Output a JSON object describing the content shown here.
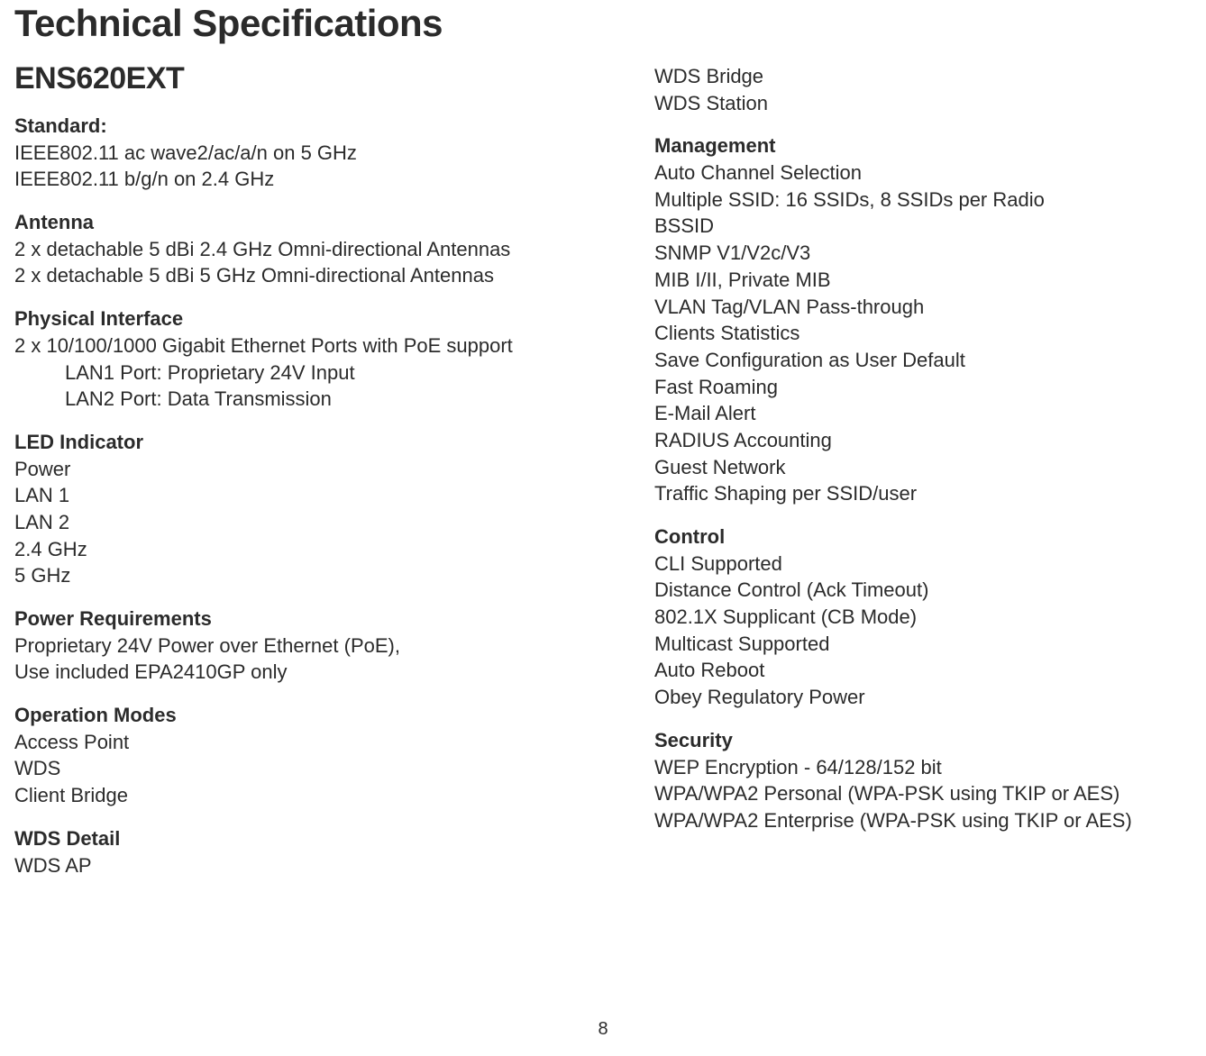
{
  "title": "Technical Specifications",
  "model": "ENS620EXT",
  "page_number": "8",
  "left": {
    "standard": {
      "head": "Standard:",
      "l1": "IEEE802.11 ac wave2/ac/a/n on 5 GHz",
      "l2": "IEEE802.11 b/g/n on 2.4 GHz"
    },
    "antenna": {
      "head": "Antenna",
      "l1": "2 x detachable 5 dBi 2.4 GHz Omni-directional Antennas",
      "l2": "2 x detachable 5 dBi 5 GHz Omni-directional Antennas"
    },
    "phys": {
      "head": "Physical Interface",
      "l1": "2 x 10/100/1000 Gigabit Ethernet Ports with PoE support",
      "l2": "LAN1 Port: Proprietary 24V Input",
      "l3": "LAN2 Port: Data Transmission"
    },
    "led": {
      "head": "LED Indicator",
      "l1": "Power",
      "l2": "LAN 1",
      "l3": "LAN 2",
      "l4": "2.4 GHz",
      "l5": "5 GHz"
    },
    "power": {
      "head": "Power Requirements",
      "l1": "Proprietary 24V Power over Ethernet (PoE),",
      "l2": "Use included EPA2410GP only"
    },
    "opmodes": {
      "head": "Operation Modes",
      "l1": "Access Point",
      "l2": "WDS",
      "l3": "Client Bridge"
    },
    "wdsdetail": {
      "head": "WDS Detail",
      "l1": "WDS AP"
    }
  },
  "right": {
    "wds_cont": {
      "l1": "WDS Bridge",
      "l2": "WDS Station"
    },
    "mgmt": {
      "head": "Management",
      "l1": "Auto Channel Selection",
      "l2": "Multiple SSID: 16 SSIDs, 8 SSIDs per Radio",
      "l3": "BSSID",
      "l4": "SNMP V1/V2c/V3",
      "l5": "MIB I/II, Private MIB",
      "l6": "VLAN Tag/VLAN Pass-through",
      "l7": "Clients Statistics",
      "l8": "Save Configuration as User Default",
      "l9": "Fast Roaming",
      "l10": "E-Mail Alert",
      "l11": "RADIUS Accounting",
      "l12": "Guest Network",
      "l13": "Traffic Shaping per SSID/user"
    },
    "control": {
      "head": "Control",
      "l1": "CLI Supported",
      "l2": "Distance Control (Ack Timeout)",
      "l3": "802.1X Supplicant (CB Mode)",
      "l4": "Multicast Supported",
      "l5": "Auto Reboot",
      "l6": "Obey Regulatory Power"
    },
    "security": {
      "head": "Security",
      "l1": "WEP Encryption - 64/128/152 bit",
      "l2": "WPA/WPA2 Personal (WPA-PSK using TKIP or AES)",
      "l3": "WPA/WPA2 Enterprise (WPA-PSK using TKIP or AES)"
    }
  }
}
